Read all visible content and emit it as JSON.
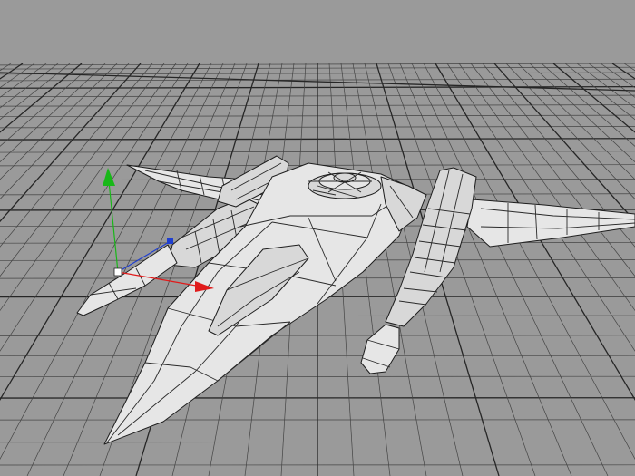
{
  "viewport": {
    "background_color": "#9a9a9a",
    "grid_color": "#444444",
    "model_fill_color": "#e6e6e6",
    "model_edge_color": "#1e1e1e"
  },
  "gizmo": {
    "x_axis_color": "#e01b1b",
    "y_axis_color": "#18b818",
    "z_axis_color": "#1f3fd0",
    "pivot_color": "#ffffff"
  },
  "icons": {
    "move_gizmo": "translate-gizmo-icon"
  }
}
